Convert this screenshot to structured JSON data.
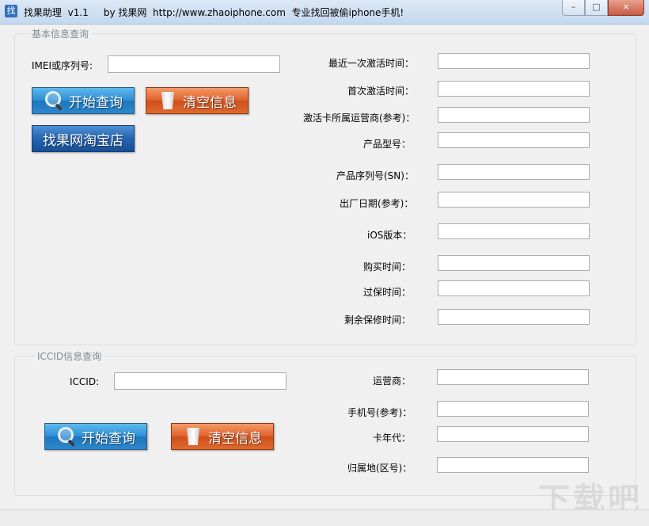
{
  "window": {
    "title": "找果助理  v1.1     by 找果网  http://www.zhaoiphone.com  专业找回被偷iphone手机!",
    "icon_char": "找",
    "controls": {
      "minimize": "–",
      "maximize": "□",
      "close": "×"
    }
  },
  "basic": {
    "legend": "基本信息查询",
    "imei_label": "IMEI或序列号:",
    "imei_value": "",
    "search_button": "开始查询",
    "clear_button": "清空信息",
    "shop_button": "找果网淘宝店",
    "fields": [
      {
        "label": "最近一次激活时间：",
        "value": ""
      },
      {
        "label": "首次激活时间：",
        "value": ""
      },
      {
        "label": "激活卡所属运营商(参考)：",
        "value": ""
      },
      {
        "label": "产品型号：",
        "value": ""
      },
      {
        "label": "产品序列号(SN)：",
        "value": ""
      },
      {
        "label": "出厂日期(参考)：",
        "value": ""
      },
      {
        "label": "iOS版本：",
        "value": ""
      },
      {
        "label": "购买时间：",
        "value": ""
      },
      {
        "label": "过保时间：",
        "value": ""
      },
      {
        "label": "剩余保修时间：",
        "value": ""
      }
    ]
  },
  "iccid": {
    "legend": "ICCID信息查询",
    "iccid_label": "ICCID:",
    "iccid_value": "",
    "search_button": "开始查询",
    "clear_button": "清空信息",
    "fields": [
      {
        "label": "运营商：",
        "value": ""
      },
      {
        "label": "手机号(参考)：",
        "value": ""
      },
      {
        "label": "卡年代：",
        "value": ""
      },
      {
        "label": "归属地(区号)：",
        "value": ""
      }
    ]
  },
  "watermark": "下载吧"
}
